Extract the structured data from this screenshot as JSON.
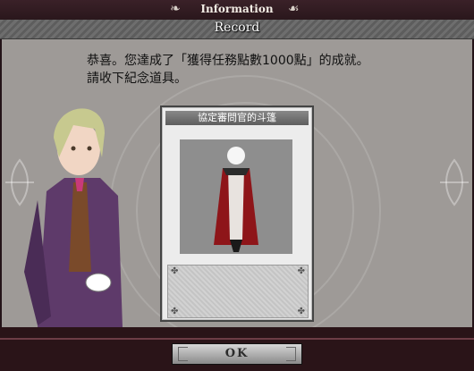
{
  "window": {
    "title": "Information"
  },
  "header": {
    "record_label": "Record"
  },
  "message": {
    "line1": "恭喜。您達成了「獲得任務點數1000點」的成就。",
    "line2": "請收下紀念道具。"
  },
  "reward_card": {
    "title": "協定審問官的斗篷",
    "icon": "cloak-costume-figure",
    "description": ""
  },
  "footer": {
    "ok_label": "OK"
  },
  "colors": {
    "titlebar": "#2a171c",
    "panel": "#9e9a97",
    "cloak_red": "#a21a1f"
  }
}
